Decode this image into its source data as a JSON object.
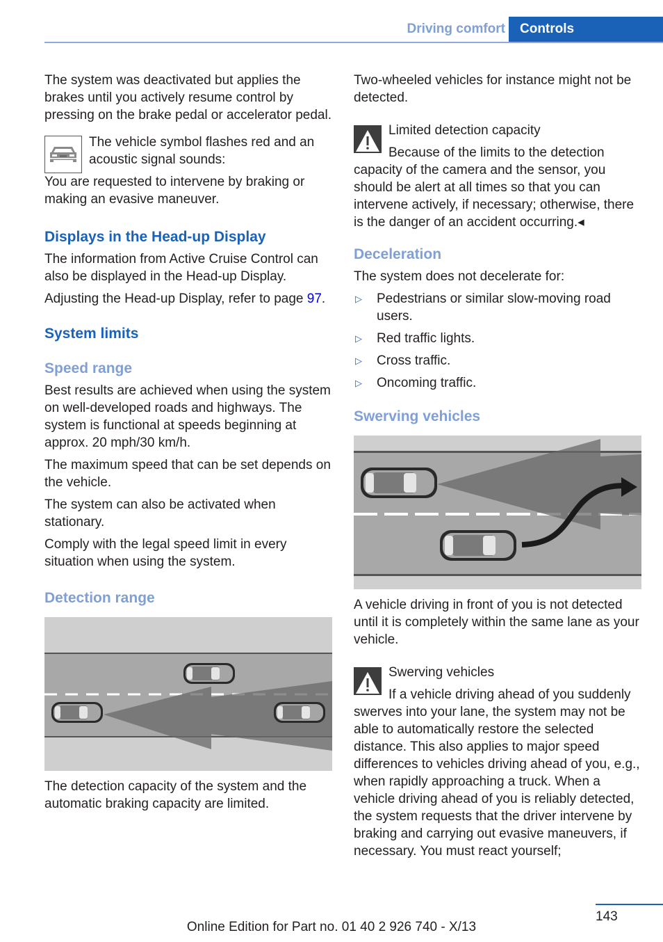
{
  "header": {
    "section": "Driving comfort",
    "tab": "Controls",
    "accent_color": "#1a62b8",
    "section_color": "#7f9fd6"
  },
  "left": {
    "intro": "The system was deactivated but applies the brakes until you actively resume control by pressing on the brake pedal or accelerator pedal.",
    "vehicle_note_line1": "The vehicle symbol flashes red and an acoustic signal sounds:",
    "vehicle_note_line2": "You are requested to intervene by braking or making an evasive maneuver.",
    "hud_heading": "Displays in the Head-up Display",
    "hud_p1": "The information from Active Cruise Control can also be displayed in the Head-up Display.",
    "hud_p2_prefix": "Adjusting the Head-up Display, refer to page ",
    "hud_p2_link": "97",
    "hud_p2_suffix": ".",
    "limits_heading": "System limits",
    "speed_heading": "Speed range",
    "speed_p1": "Best results are achieved when using the system on well-developed roads and highways. The system is functional at speeds beginning at approx. 20 mph/30 km/h.",
    "speed_p2": "The maximum speed that can be set depends on the vehicle.",
    "speed_p3": "The system can also be activated when stationary.",
    "speed_p4": "Comply with the legal speed limit in every situation when using the system.",
    "detection_heading": "Detection range",
    "detection_caption": "The detection capacity of the system and the automatic braking capacity are limited."
  },
  "right": {
    "intro": "Two-wheeled vehicles for instance might not be detected.",
    "warning1_title": "Limited detection capacity",
    "warning1_body": "Because of the limits to the detection capacity of the camera and the sensor, you should be alert at all times so that you can intervene actively, if necessary; otherwise, there is the danger of an accident occurring.◂",
    "decel_heading": "Deceleration",
    "decel_intro": "The system does not decelerate for:",
    "decel_items": [
      "Pedestrians or similar slow-moving road users.",
      "Red traffic lights.",
      "Cross traffic.",
      "Oncoming traffic."
    ],
    "bullet_glyph": "▷",
    "swerve_heading": "Swerving vehicles",
    "swerve_caption": "A vehicle driving in front of you is not detected until it is completely within the same lane as your vehicle.",
    "warning2_title": "Swerving vehicles",
    "warning2_body": "If a vehicle driving ahead of you suddenly swerves into your lane, the system may not be able to automatically restore the selected distance. This also applies to major speed differences to vehicles driving ahead of you, e.g., when rapidly approaching a truck. When a vehicle driving ahead of you is reliably detected, the system requests that the driver intervene by braking and carrying out evasive maneuvers, if necessary. You must react yourself;"
  },
  "footer": {
    "page_number": "143",
    "edition": "Online Edition for Part no. 01 40 2 926 740 - X/13"
  }
}
